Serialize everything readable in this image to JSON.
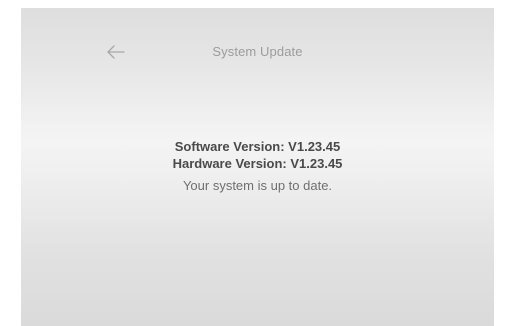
{
  "header": {
    "back_icon": "arrow-left-icon",
    "title": "System Update"
  },
  "info": {
    "software_version": "Software Version: V1.23.45",
    "hardware_version": "Hardware Version: V1.23.45",
    "status": "Your system is up to date."
  },
  "colors": {
    "title_text": "#9c9c9c",
    "version_text": "#4a4a4a",
    "status_text": "#6f6f6f"
  }
}
